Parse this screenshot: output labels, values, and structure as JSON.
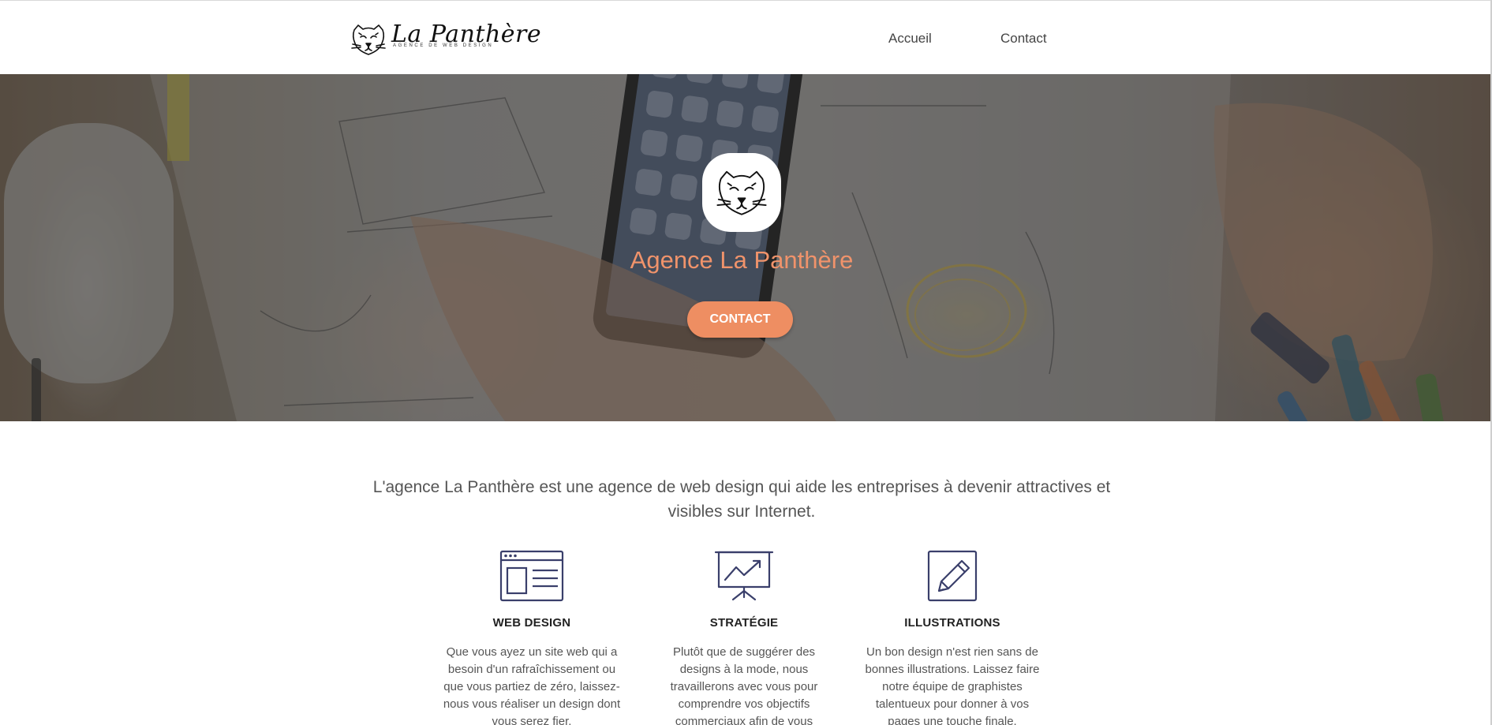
{
  "brand": {
    "name": "La Panthère",
    "tagline": "AGENCE DE WEB DESIGN"
  },
  "nav": {
    "home_label": "Accueil",
    "contact_label": "Contact"
  },
  "hero": {
    "title": "Agence La Panthère",
    "button_label": "CONTACT"
  },
  "intro": {
    "text": "L'agence La Panthère est une agence de web design qui aide les entreprises à devenir attractives et visibles sur Internet."
  },
  "features": [
    {
      "icon": "browser-window-icon",
      "title": "WEB DESIGN",
      "text": "Que vous ayez un site web qui a besoin d'un rafraîchissement ou que vous partiez de zéro, laissez-nous vous réaliser un design dont vous serez fier."
    },
    {
      "icon": "presentation-chart-icon",
      "title": "STRATÉGIE",
      "text": "Plutôt que de suggérer des designs à la mode, nous travaillerons avec vous pour comprendre vos objectifs commerciaux afin de vous proposer le meilleur design."
    },
    {
      "icon": "pencil-icon",
      "title": "ILLUSTRATIONS",
      "text": "Un bon design n'est rien sans de bonnes illustrations. Laissez faire notre équipe de graphistes talentueux pour donner à vos pages une touche finale."
    }
  ],
  "colors": {
    "accent": "#ee8e62",
    "hero_title": "#f0936b",
    "icon_stroke": "#3a3f6b",
    "text": "#555555"
  }
}
